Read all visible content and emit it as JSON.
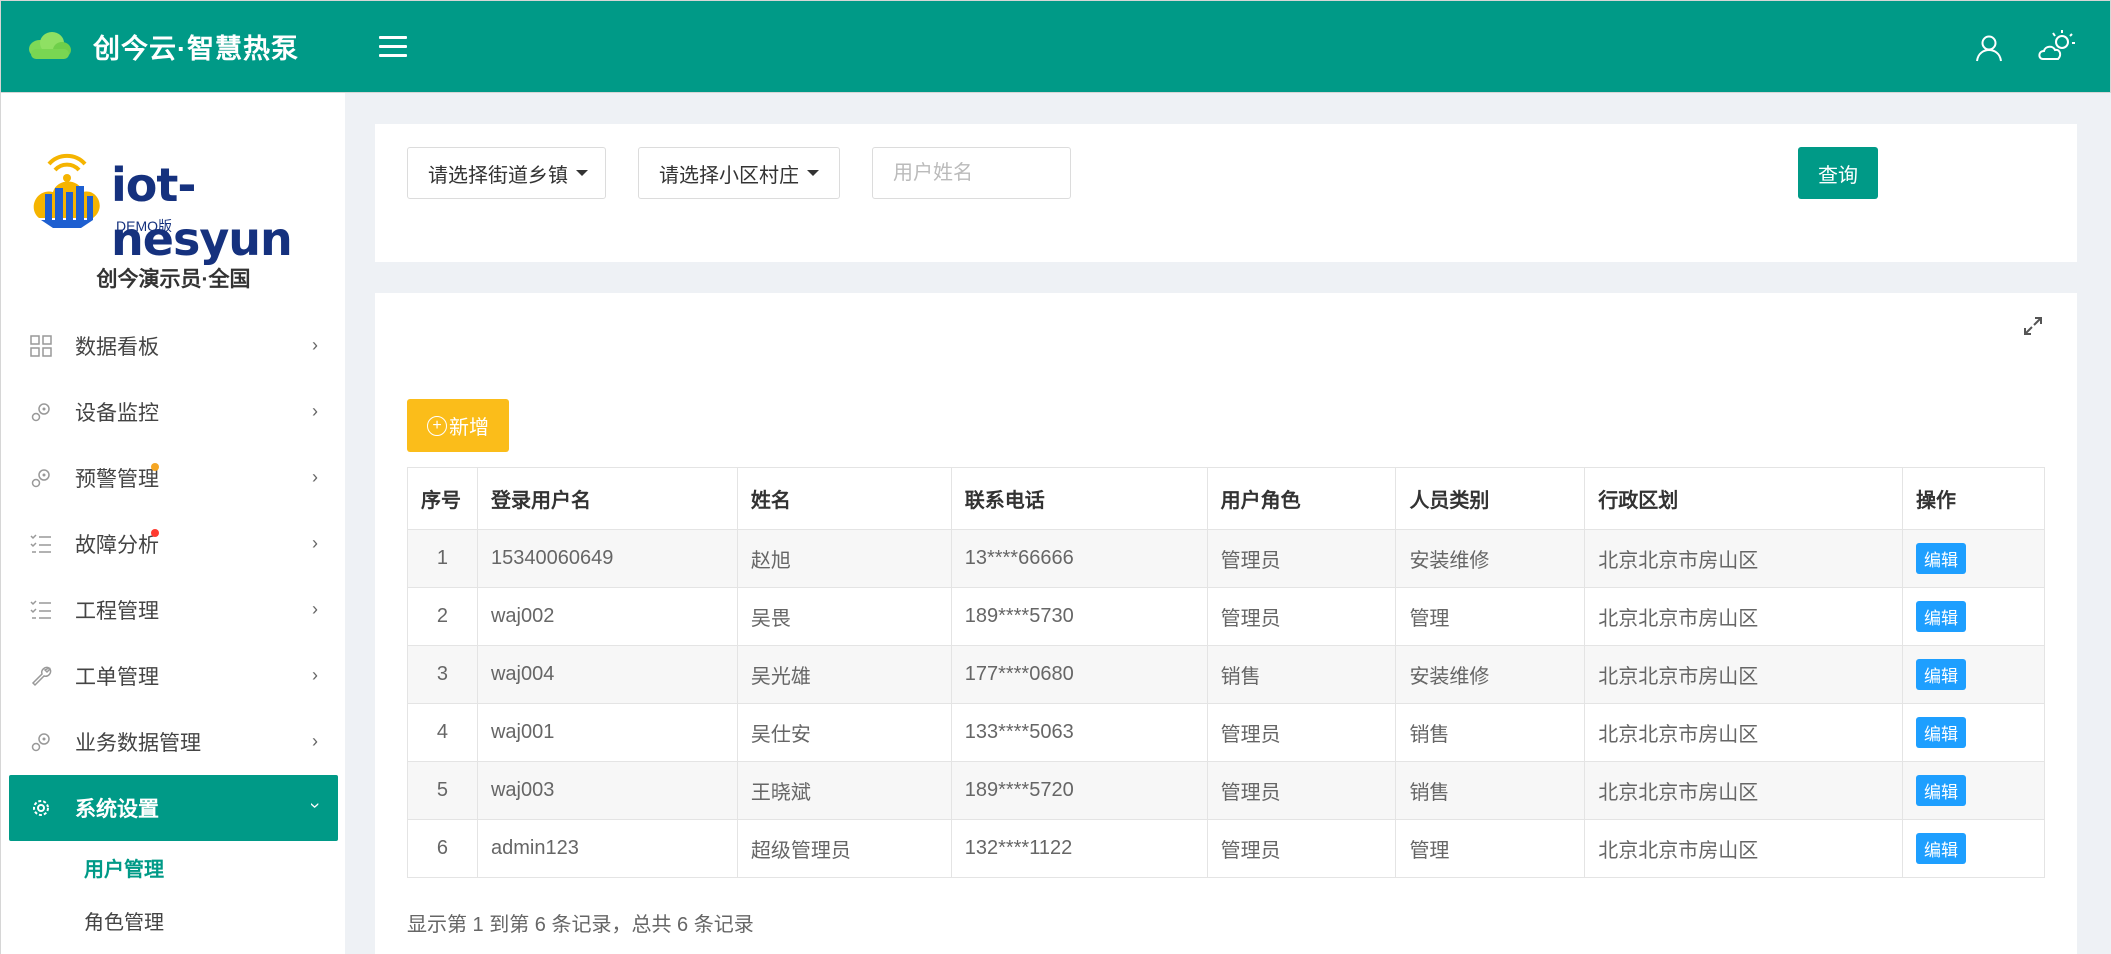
{
  "header": {
    "app_title": "创今云·智慧热泵",
    "menu_toggle_icon": "hamburger-icon",
    "user_icon": "user-icon",
    "weather_icon": "weather-icon"
  },
  "sidebar": {
    "brand_text": "iot-nesyun",
    "brand_sub": "DEMO版",
    "user_org": "创今演示员·全国",
    "items": [
      {
        "label": "数据看板",
        "icon": "dashboard-icon"
      },
      {
        "label": "设备监控",
        "icon": "gears-icon"
      },
      {
        "label": "预警管理",
        "icon": "gears-icon",
        "badge_color": "#f5a623"
      },
      {
        "label": "故障分析",
        "icon": "list-icon",
        "badge_color": "#ff3b30"
      },
      {
        "label": "工程管理",
        "icon": "list-icon"
      },
      {
        "label": "工单管理",
        "icon": "wrench-icon"
      },
      {
        "label": "业务数据管理",
        "icon": "gears-icon"
      },
      {
        "label": "系统设置",
        "icon": "settings-icon"
      }
    ],
    "sub_items": [
      {
        "label": "用户管理"
      },
      {
        "label": "角色管理"
      }
    ]
  },
  "filters": {
    "street_select": "请选择街道乡镇",
    "village_select": "请选择小区村庄",
    "name_placeholder": "用户姓名",
    "query_button": "查询"
  },
  "table": {
    "add_button": "新增",
    "columns": [
      "序号",
      "登录用户名",
      "姓名",
      "联系电话",
      "用户角色",
      "人员类别",
      "行政区划",
      "操作"
    ],
    "rows": [
      {
        "idx": "1",
        "username": "15340060649",
        "name": "赵旭",
        "phone": "13****66666",
        "role": "管理员",
        "category": "安装维修",
        "region": "北京北京市房山区",
        "action": "编辑"
      },
      {
        "idx": "2",
        "username": "waj002",
        "name": "吴畏",
        "phone": "189****5730",
        "role": "管理员",
        "category": "管理",
        "region": "北京北京市房山区",
        "action": "编辑"
      },
      {
        "idx": "3",
        "username": "waj004",
        "name": "吴光雄",
        "phone": "177****0680",
        "role": "销售",
        "category": "安装维修",
        "region": "北京北京市房山区",
        "action": "编辑"
      },
      {
        "idx": "4",
        "username": "waj001",
        "name": "吴仕安",
        "phone": "133****5063",
        "role": "管理员",
        "category": "销售",
        "region": "北京北京市房山区",
        "action": "编辑"
      },
      {
        "idx": "5",
        "username": "waj003",
        "name": "王晓斌",
        "phone": "189****5720",
        "role": "管理员",
        "category": "销售",
        "region": "北京北京市房山区",
        "action": "编辑"
      },
      {
        "idx": "6",
        "username": "admin123",
        "name": "超级管理员",
        "phone": "132****1122",
        "role": "管理员",
        "category": "管理",
        "region": "北京北京市房山区",
        "action": "编辑"
      }
    ],
    "summary": "显示第 1 到第 6 条记录，总共 6 条记录"
  },
  "colors": {
    "primary": "#009a87",
    "warning": "#fbbd1a",
    "edit": "#1e9fff"
  }
}
